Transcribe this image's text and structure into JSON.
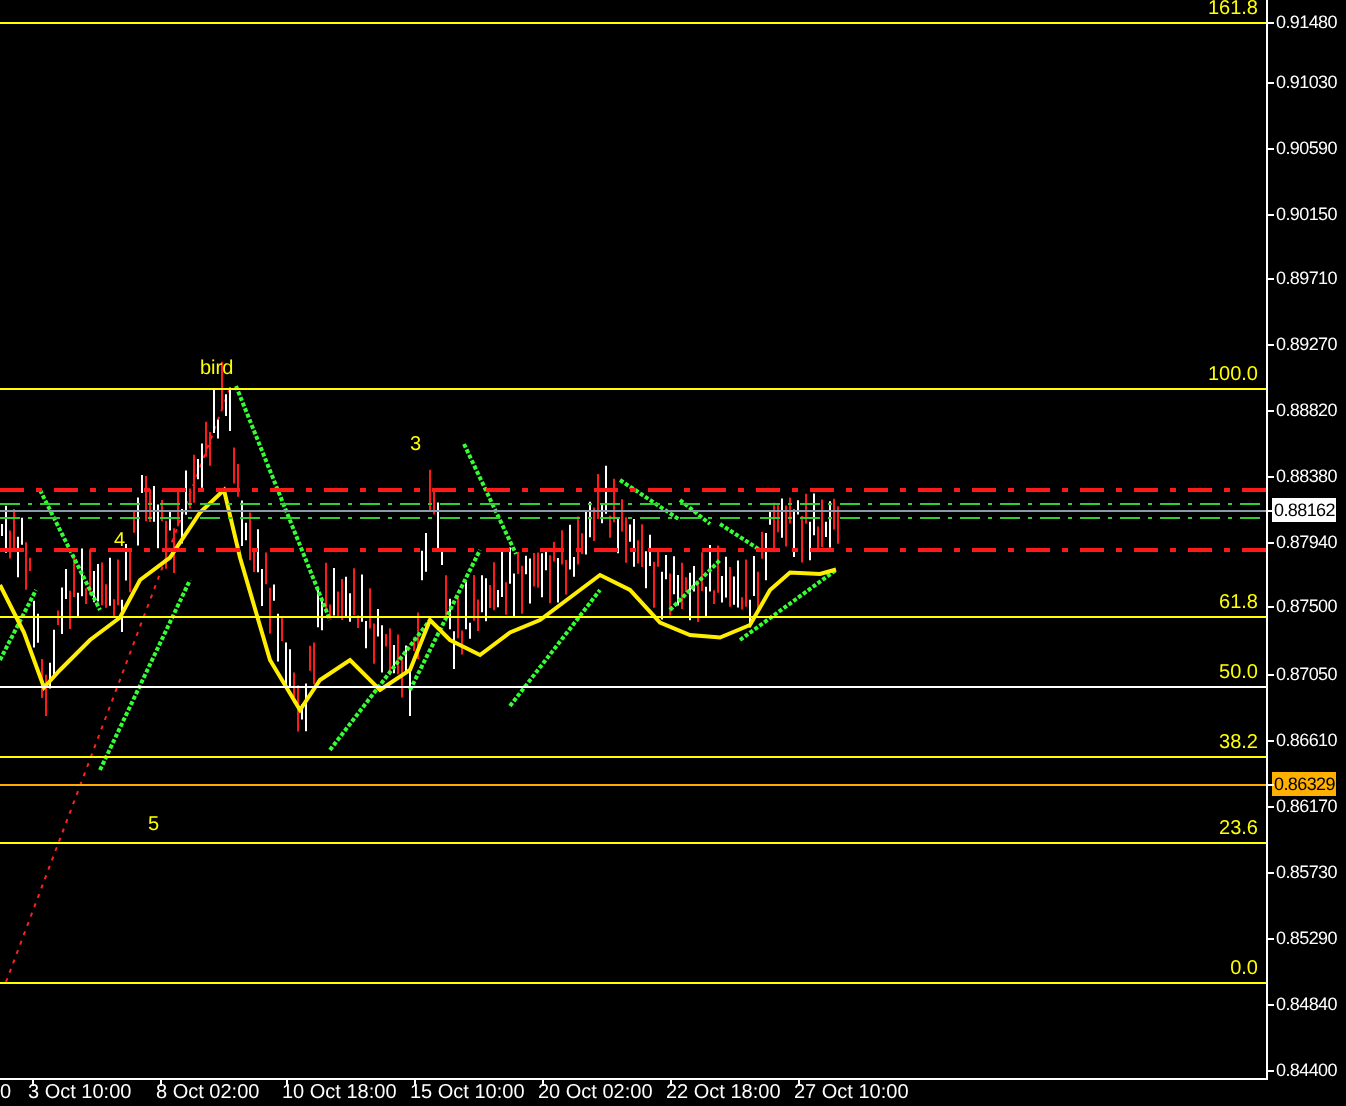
{
  "chart": {
    "fib_levels": [
      {
        "label": "161.8"
      },
      {
        "label": "100.0"
      },
      {
        "label": "61.8"
      },
      {
        "label": "50.0"
      },
      {
        "label": "38.2"
      },
      {
        "label": "23.6"
      },
      {
        "label": "0.0"
      }
    ],
    "markers": [
      {
        "label": "bird"
      },
      {
        "label": "3"
      },
      {
        "label": "4"
      },
      {
        "label": "5"
      }
    ],
    "price_labels": [
      {
        "text": "0.91480",
        "kind": "tick"
      },
      {
        "text": "0.91030",
        "kind": "tick"
      },
      {
        "text": "0.90590",
        "kind": "tick"
      },
      {
        "text": "0.90150",
        "kind": "tick"
      },
      {
        "text": "0.89710",
        "kind": "tick"
      },
      {
        "text": "0.89270",
        "kind": "tick"
      },
      {
        "text": "0.88820",
        "kind": "tick"
      },
      {
        "text": "0.88380",
        "kind": "tick"
      },
      {
        "text": "0.88162",
        "kind": "current"
      },
      {
        "text": "0.87940",
        "kind": "tick"
      },
      {
        "text": "0.87500",
        "kind": "tick"
      },
      {
        "text": "0.87050",
        "kind": "tick"
      },
      {
        "text": "0.86610",
        "kind": "tick"
      },
      {
        "text": "0.86329",
        "kind": "level"
      },
      {
        "text": "0.86170",
        "kind": "tick"
      },
      {
        "text": "0.85730",
        "kind": "tick"
      },
      {
        "text": "0.85290",
        "kind": "tick"
      },
      {
        "text": "0.84840",
        "kind": "tick"
      },
      {
        "text": "0.84400",
        "kind": "tick"
      }
    ],
    "time_labels": [
      {
        "text": "0"
      },
      {
        "text": "3 Oct 10:00"
      },
      {
        "text": "8 Oct 02:00"
      },
      {
        "text": "10 Oct 18:00"
      },
      {
        "text": "15 Oct 10:00"
      },
      {
        "text": "20 Oct 02:00"
      },
      {
        "text": "22 Oct 18:00"
      },
      {
        "text": "27 Oct 10:00"
      }
    ]
  }
}
